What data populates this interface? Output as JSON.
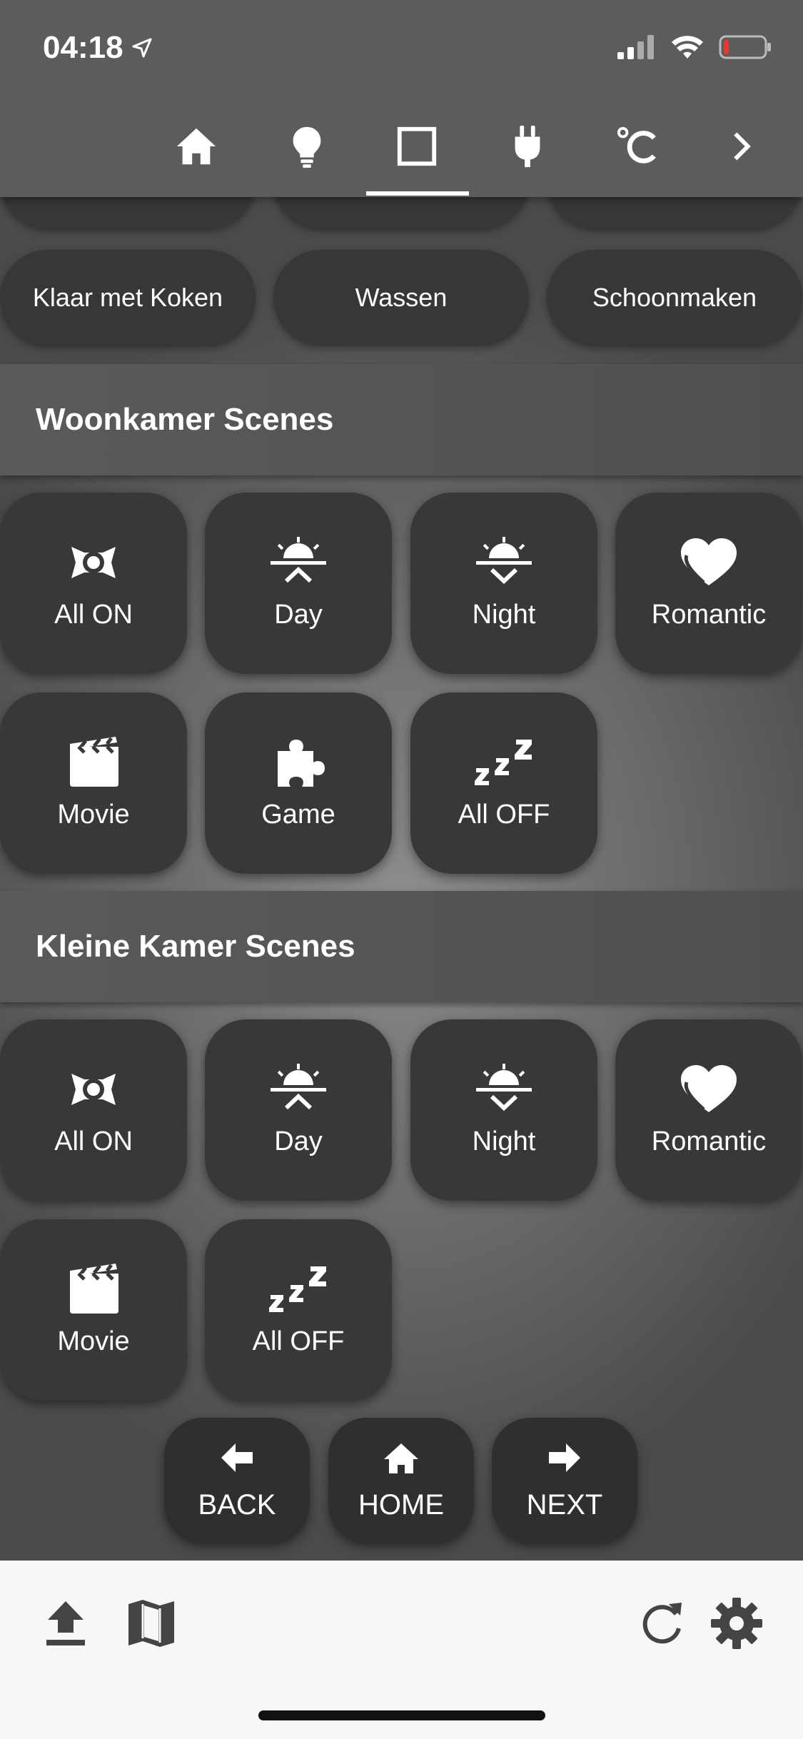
{
  "status_bar": {
    "time": "04:18"
  },
  "tabs": [
    {
      "icon": "home-icon",
      "active": false
    },
    {
      "icon": "lightbulb-icon",
      "active": false
    },
    {
      "icon": "square-icon",
      "active": true
    },
    {
      "icon": "plug-icon",
      "active": false
    },
    {
      "icon": "celsius-icon",
      "active": false
    },
    {
      "icon": "chevron-right-icon",
      "active": false
    }
  ],
  "quick_actions": [
    "Klaar met Koken",
    "Wassen",
    "Schoonmaken"
  ],
  "sections": [
    {
      "title": "Woonkamer Scenes",
      "scenes": [
        {
          "label": "All ON",
          "icon": "all-on-icon"
        },
        {
          "label": "Day",
          "icon": "sunrise-icon"
        },
        {
          "label": "Night",
          "icon": "sunset-icon"
        },
        {
          "label": "Romantic",
          "icon": "heart-icon"
        },
        {
          "label": "Movie",
          "icon": "clapperboard-icon"
        },
        {
          "label": "Game",
          "icon": "puzzle-icon"
        },
        {
          "label": "All OFF",
          "icon": "sleep-icon"
        }
      ]
    },
    {
      "title": "Kleine Kamer Scenes",
      "scenes": [
        {
          "label": "All ON",
          "icon": "all-on-icon"
        },
        {
          "label": "Day",
          "icon": "sunrise-icon"
        },
        {
          "label": "Night",
          "icon": "sunset-icon"
        },
        {
          "label": "Romantic",
          "icon": "heart-icon"
        },
        {
          "label": "Movie",
          "icon": "clapperboard-icon"
        },
        {
          "label": "All OFF",
          "icon": "sleep-icon"
        }
      ]
    }
  ],
  "navigation": {
    "back": "BACK",
    "home": "HOME",
    "next": "NEXT"
  },
  "bottom_bar": {
    "left_icons": [
      "upload-icon",
      "map-icon"
    ],
    "right_icons": [
      "refresh-icon",
      "settings-icon"
    ]
  }
}
